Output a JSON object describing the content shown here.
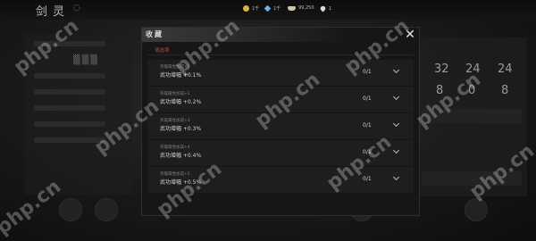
{
  "hud": {
    "game_title": "剑灵",
    "currencies": [
      {
        "icon": "gold-coin-icon",
        "value": "1千"
      },
      {
        "icon": "gem-icon",
        "value": "1千"
      },
      {
        "icon": "silver-ingot-icon",
        "value": "99,250"
      },
      {
        "icon": "water-drop-icon",
        "value": "1"
      }
    ],
    "right_stats_top": [
      "32",
      "24",
      "24"
    ],
    "right_stats_bottom": [
      "8",
      "0",
      "8"
    ]
  },
  "modal": {
    "title": "收藏",
    "section": "清选项",
    "options": [
      {
        "tag": "英雄属性加成+1",
        "label": "武功增幅 +0.1%",
        "count": "0/1"
      },
      {
        "tag": "英雄属性加成+2",
        "label": "武功增幅 +0.2%",
        "count": "0/1"
      },
      {
        "tag": "英雄属性加成+3",
        "label": "武功增幅 +0.3%",
        "count": "0/1"
      },
      {
        "tag": "英雄属性加成+4",
        "label": "武功增幅 +0.4%",
        "count": "0/1"
      },
      {
        "tag": "英雄属性加成+5",
        "label": "武功增幅 +0.5%",
        "count": "0/1"
      }
    ]
  },
  "watermark": "php.cn"
}
